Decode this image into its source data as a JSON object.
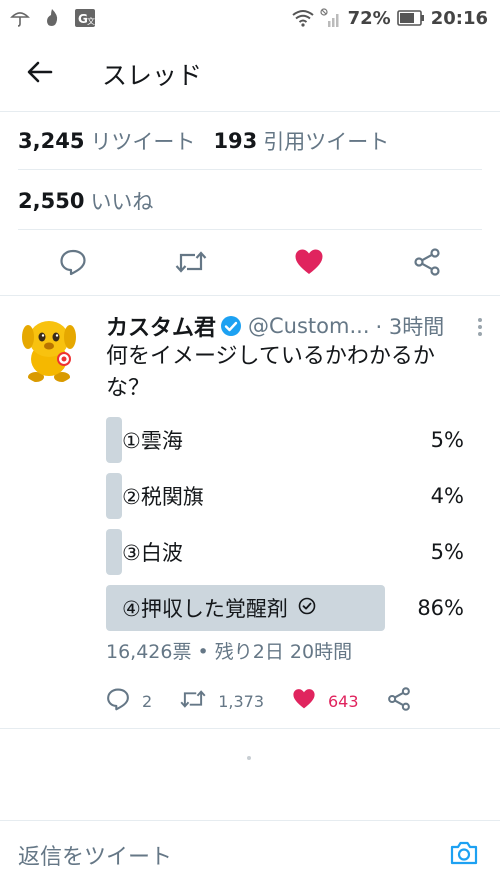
{
  "status_bar": {
    "battery_percent": "72%",
    "time": "20:16"
  },
  "header": {
    "title": "スレッド"
  },
  "stats": {
    "retweets_count": "3,245",
    "retweets_label": "リツイート",
    "quotes_count": "193",
    "quotes_label": "引用ツイート",
    "likes_count": "2,550",
    "likes_label": "いいね"
  },
  "tweet": {
    "author_name": "カスタム君",
    "handle": "@Custom...",
    "time": "· 3時間",
    "text": "何をイメージしているかわかるかな？",
    "poll": {
      "options": [
        {
          "label": "①雲海",
          "percent": "5%",
          "fraction": 0.05,
          "selected": false
        },
        {
          "label": "②税関旗",
          "percent": "4%",
          "fraction": 0.04,
          "selected": false
        },
        {
          "label": "③白波",
          "percent": "5%",
          "fraction": 0.05,
          "selected": false
        },
        {
          "label": "④押収した覚醒剤",
          "percent": "86%",
          "fraction": 0.86,
          "selected": true
        }
      ],
      "meta": "16,426票 • 残り2日 20時間"
    },
    "actions": {
      "replies": "2",
      "retweets": "1,373",
      "likes": "643"
    }
  },
  "reply": {
    "placeholder": "返信をツイート"
  },
  "colors": {
    "accent": "#1da1f2",
    "like": "#e0245e",
    "secondary_text": "#657786",
    "poll_bar": "#ccd6dd"
  },
  "icons": [
    "umbrella-icon",
    "flame-icon",
    "translate-icon",
    "wifi-icon",
    "signal-icon",
    "battery-icon",
    "back-arrow-icon",
    "reply-icon",
    "retweet-icon",
    "heart-icon",
    "share-icon",
    "verified-icon",
    "more-vertical-icon",
    "check-circle-icon",
    "camera-icon"
  ]
}
